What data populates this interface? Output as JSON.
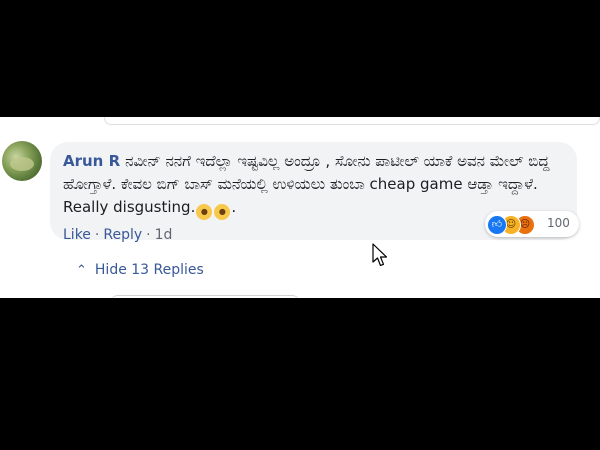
{
  "comment": {
    "author": "Arun R",
    "text_part1": "ನವೀನ್ ನನಗೆ ಇದೆಲ್ಲಾ ಇಷ್ಟವಿಲ್ಲ ಅಂದ್ರೂ , ಸೋನು ಪಾಟೀಲ್ ಯಾಕೆ ಅವನ ಮೇಲ್ ಬಿದ್ದ ಹೋಗ್ತಾಳೆ. ಕೇವಲ ಬಿಗ್ ಬಾಸ್ ಮನೆಯಲ್ಲಿ ಉಳಿಯಲು ತುಂಬಾ cheap game ಆಡ್ತಾ ಇದ್ದಾಳೆ. Really disgusting.",
    "text_end": ".",
    "emojis": [
      "angry-face-emoji",
      "angry-face-emoji"
    ]
  },
  "reactions": {
    "icons": [
      "like-icon",
      "haha-icon",
      "angry-icon"
    ],
    "count": "100"
  },
  "actions": {
    "like": "Like",
    "reply": "Reply",
    "time": "1d",
    "separator": "·"
  },
  "replies": {
    "toggle_label": "Hide 13 Replies"
  },
  "colors": {
    "link": "#385898",
    "bubble": "#f2f3f5",
    "text": "#1c1e21",
    "meta": "#606770"
  }
}
